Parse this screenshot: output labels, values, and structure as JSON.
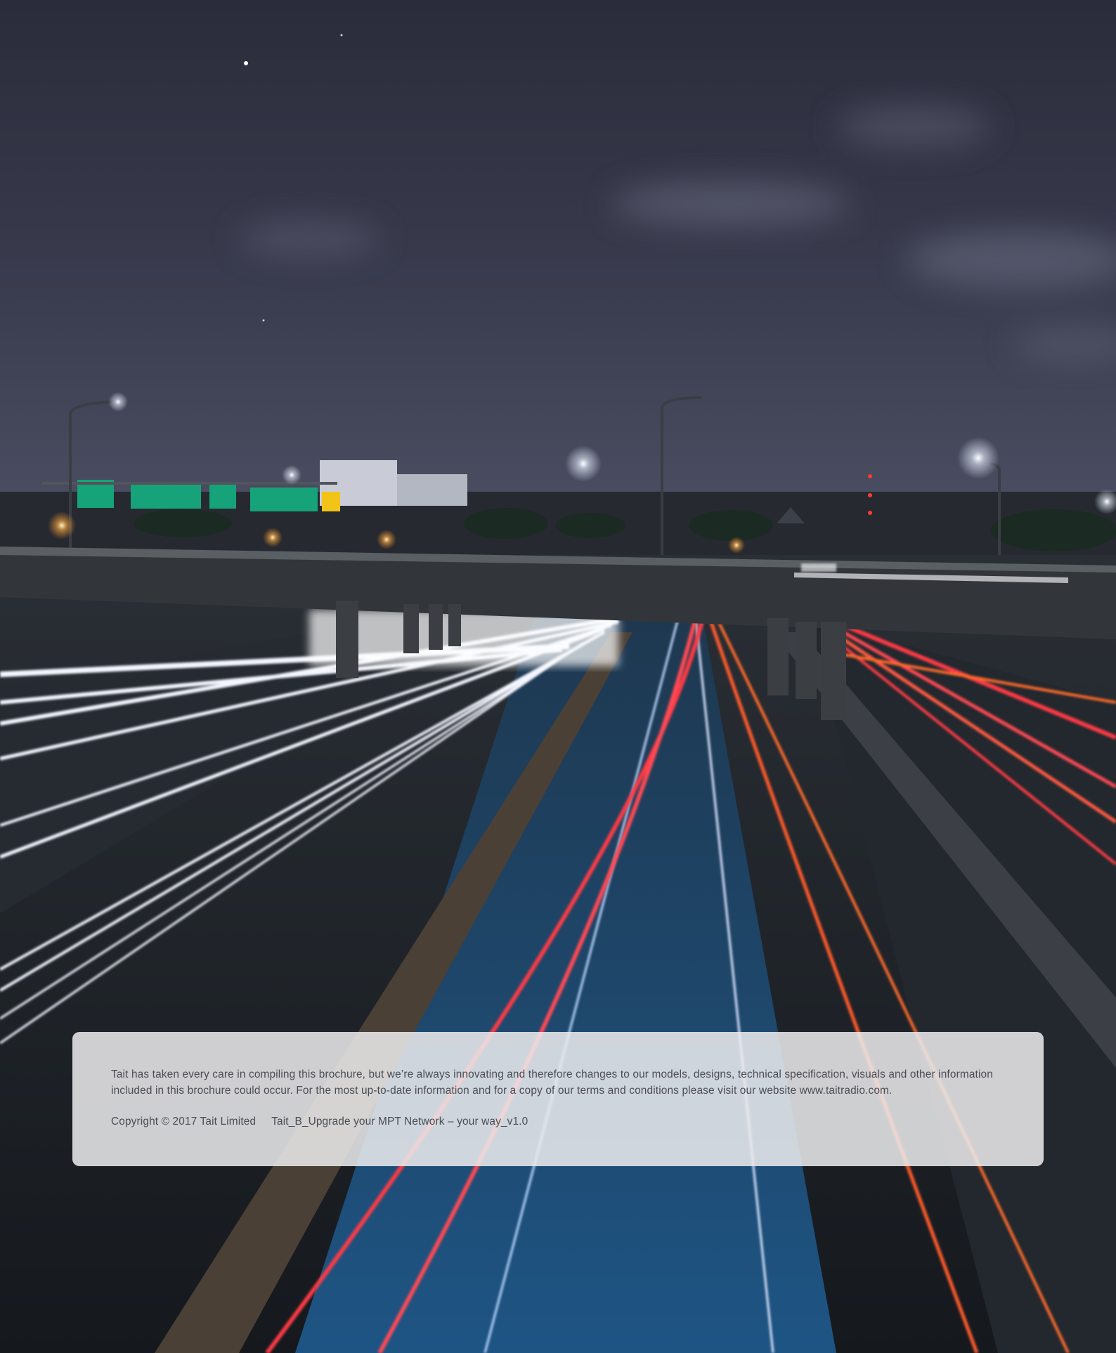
{
  "scene": {
    "description_icon": "highway-night-light-trails-photo",
    "colors": {
      "sky_top": "#2b2d3c",
      "sky_horizon": "#4a4c62",
      "asphalt": "#1f2328",
      "overpass": "#36393c",
      "head_light": "#f4f6ff",
      "tail_light": "#ff3b44",
      "orange_trail": "#ff6a2a",
      "road_blue": "#2e7fc0",
      "sign_green": "#16a37a"
    }
  },
  "disclaimer": {
    "text": "Tait has taken every care in compiling this brochure, but we’re always innovating and therefore changes to our models, designs, technical specification, visuals and other information included in this brochure could occur. For the most up-to-date information and for a copy of our terms and conditions please visit our website www.taitradio.com.",
    "copyright": "Copyright © 2017 Tait Limited",
    "document_id": "Tait_B_Upgrade your MPT Network – your way_v1.0"
  }
}
